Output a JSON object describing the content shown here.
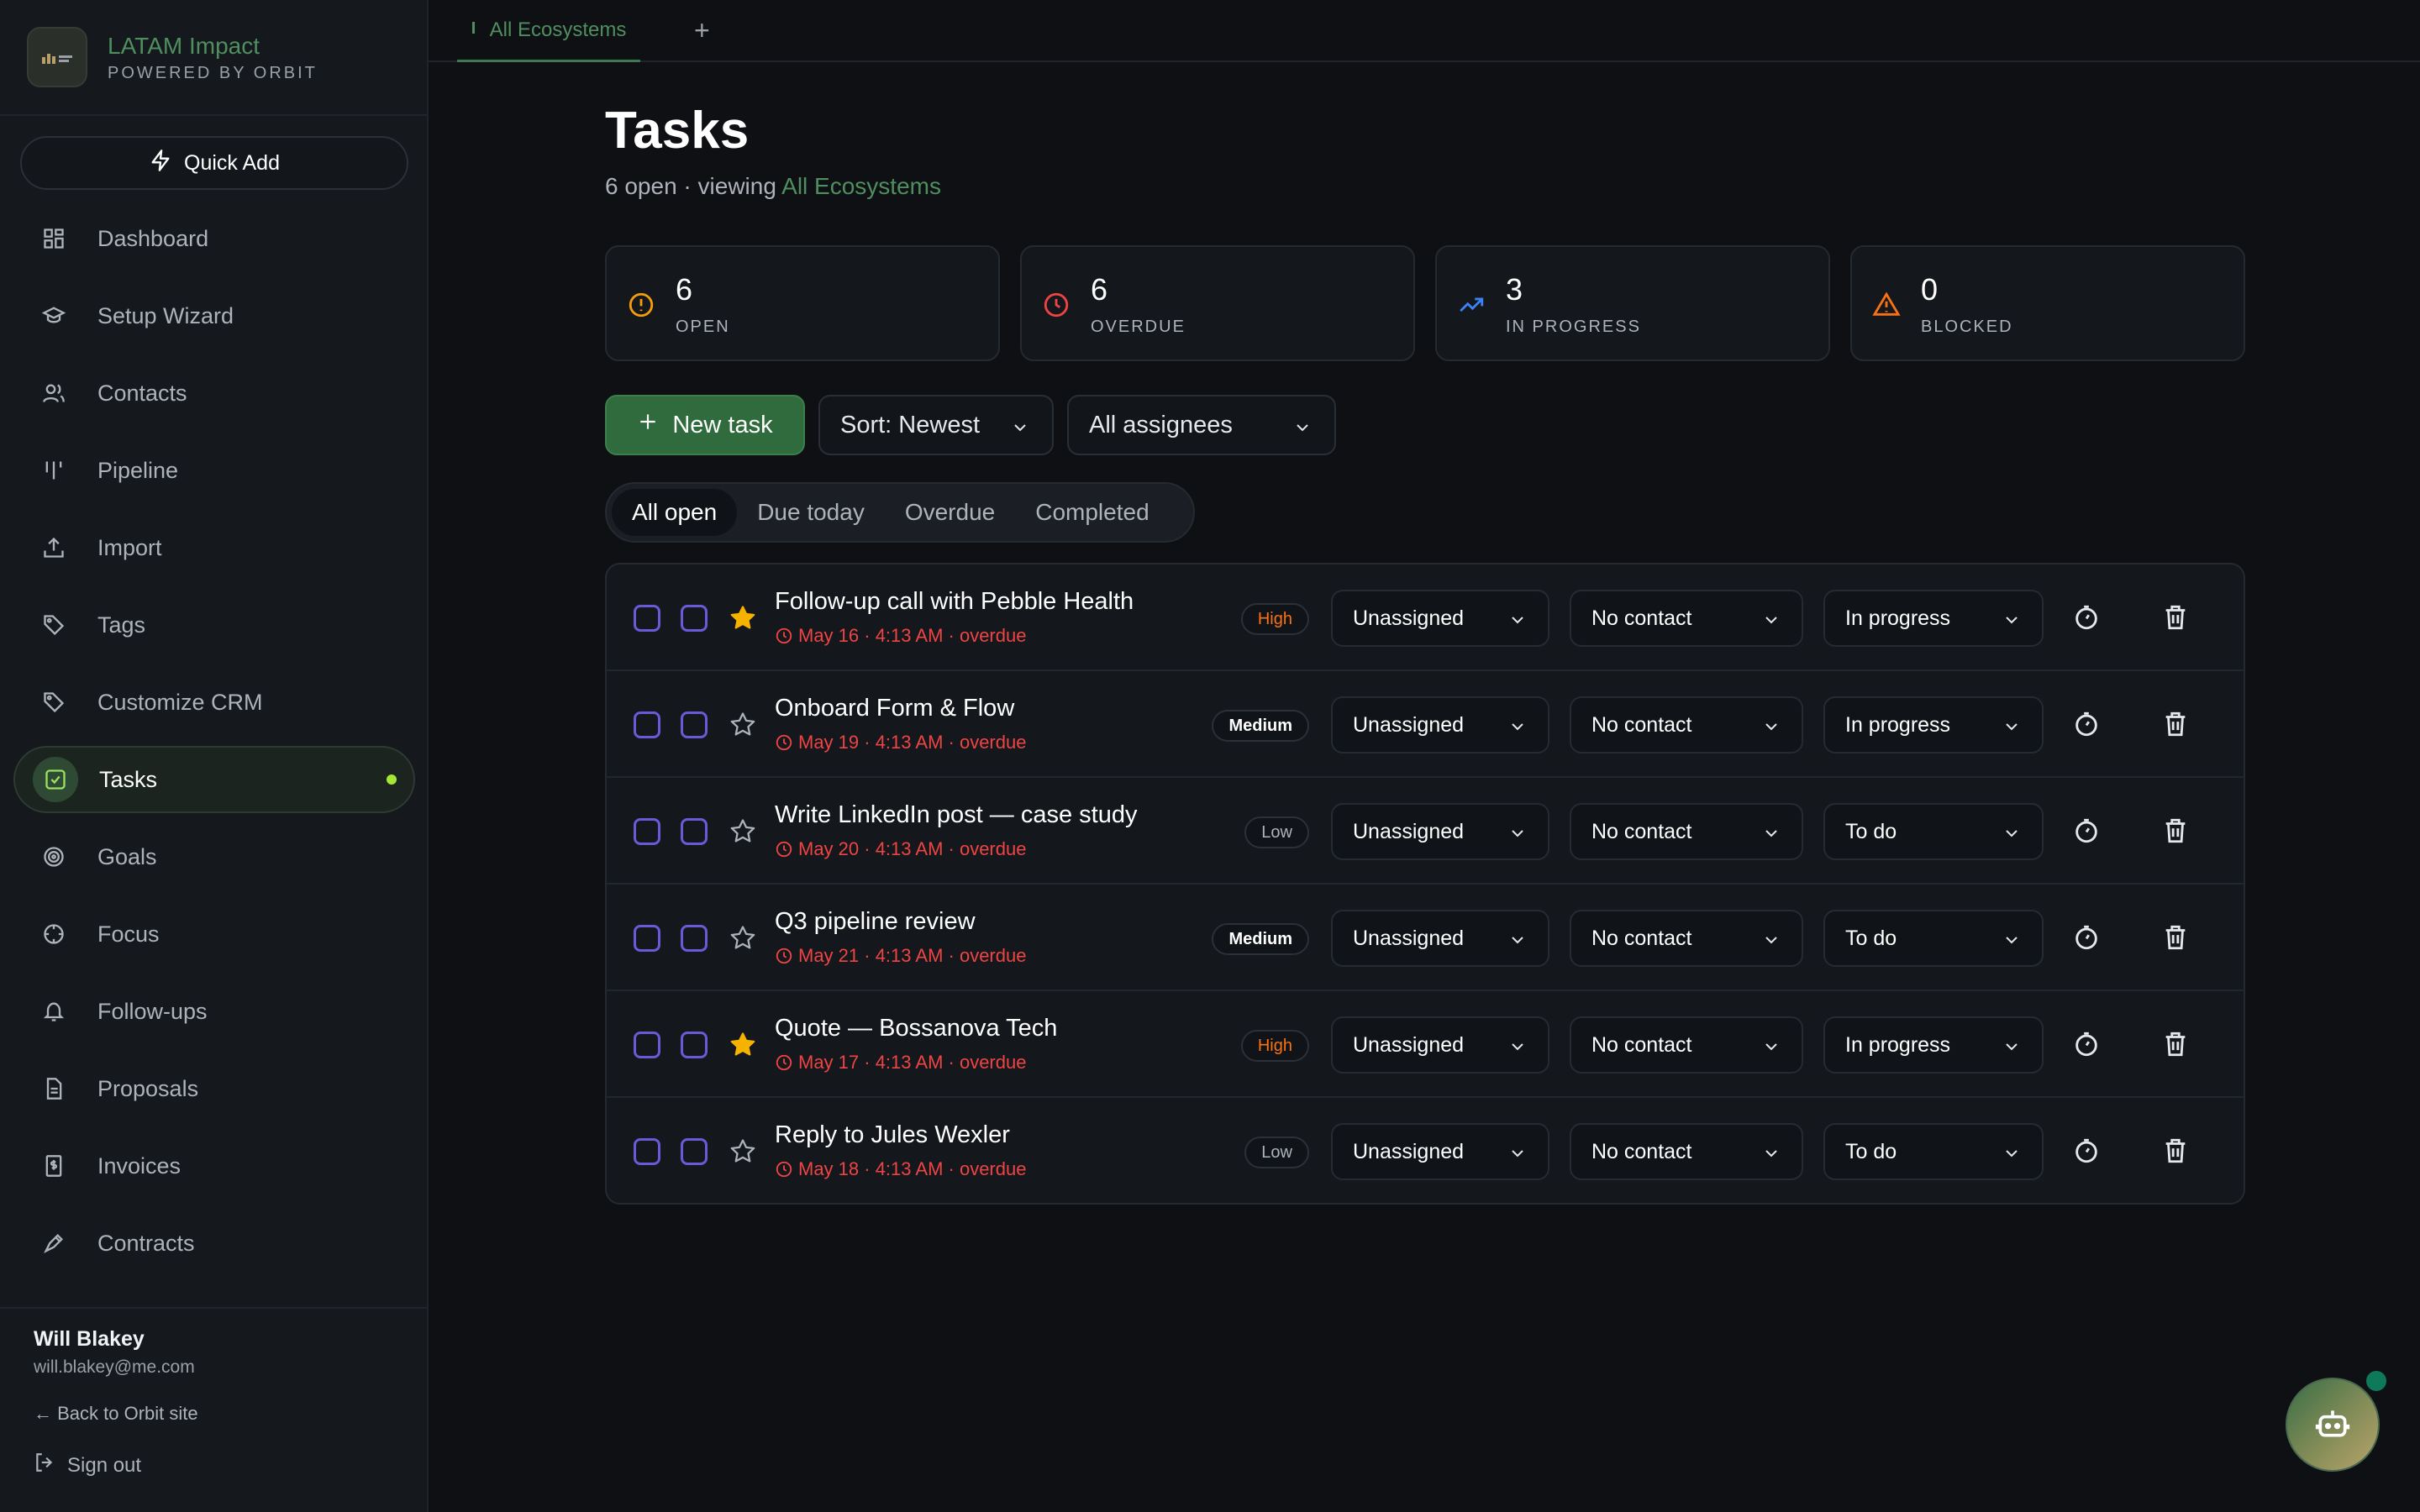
{
  "brand": {
    "name": "LATAM Impact",
    "tagline": "POWERED BY ORBIT"
  },
  "quick_add_label": "Quick Add",
  "nav": [
    {
      "label": "Dashboard",
      "icon": "dashboard-icon"
    },
    {
      "label": "Setup Wizard",
      "icon": "graduation-cap-icon"
    },
    {
      "label": "Contacts",
      "icon": "users-icon"
    },
    {
      "label": "Pipeline",
      "icon": "pipeline-icon"
    },
    {
      "label": "Import",
      "icon": "upload-icon"
    },
    {
      "label": "Tags",
      "icon": "tag-icon"
    },
    {
      "label": "Customize CRM",
      "icon": "tag-icon"
    },
    {
      "label": "Tasks",
      "icon": "checkbox-icon",
      "active": true
    },
    {
      "label": "Goals",
      "icon": "target-icon"
    },
    {
      "label": "Focus",
      "icon": "crosshair-icon"
    },
    {
      "label": "Follow-ups",
      "icon": "bell-icon"
    },
    {
      "label": "Proposals",
      "icon": "document-icon"
    },
    {
      "label": "Invoices",
      "icon": "invoice-icon"
    },
    {
      "label": "Contracts",
      "icon": "pen-icon"
    }
  ],
  "user": {
    "name": "Will Blakey",
    "email": "will.blakey@me.com"
  },
  "back_link": "← Back to Orbit site",
  "sign_out": "Sign out",
  "top_tab": "All Ecosystems",
  "add_tab": "+",
  "page": {
    "title": "Tasks",
    "subtitle_prefix": "6 open · viewing",
    "subtitle_accent": "All Ecosystems"
  },
  "stats": [
    {
      "value": "6",
      "label": "OPEN",
      "icon": "alert-circle-icon",
      "color": "#f59e0b"
    },
    {
      "value": "6",
      "label": "OVERDUE",
      "icon": "clock-icon",
      "color": "#ef4444"
    },
    {
      "value": "3",
      "label": "IN PROGRESS",
      "icon": "trending-up-icon",
      "color": "#3b82f6"
    },
    {
      "value": "0",
      "label": "BLOCKED",
      "icon": "warning-triangle-icon",
      "color": "#f97316"
    }
  ],
  "toolbar": {
    "new_task": "New task",
    "sort": "Sort: Newest",
    "assignees": "All assignees"
  },
  "filter_tabs": [
    "All open",
    "Due today",
    "Overdue",
    "Completed"
  ],
  "tasks": [
    {
      "title": "Follow-up call with Pebble Health",
      "due": "May 16 · 4:13 AM · overdue",
      "priority": "High",
      "assignee": "Unassigned",
      "contact": "No contact",
      "status": "In progress",
      "starred": true
    },
    {
      "title": "Onboard Form & Flow",
      "due": "May 19 · 4:13 AM · overdue",
      "priority": "Medium",
      "assignee": "Unassigned",
      "contact": "No contact",
      "status": "In progress",
      "starred": false
    },
    {
      "title": "Write LinkedIn post — case study",
      "due": "May 20 · 4:13 AM · overdue",
      "priority": "Low",
      "assignee": "Unassigned",
      "contact": "No contact",
      "status": "To do",
      "starred": false
    },
    {
      "title": "Q3 pipeline review",
      "due": "May 21 · 4:13 AM · overdue",
      "priority": "Medium",
      "assignee": "Unassigned",
      "contact": "No contact",
      "status": "To do",
      "starred": false
    },
    {
      "title": "Quote — Bossanova Tech",
      "due": "May 17 · 4:13 AM · overdue",
      "priority": "High",
      "assignee": "Unassigned",
      "contact": "No contact",
      "status": "In progress",
      "starred": true
    },
    {
      "title": "Reply to Jules Wexler",
      "due": "May 18 · 4:13 AM · overdue",
      "priority": "Low",
      "assignee": "Unassigned",
      "contact": "No contact",
      "status": "To do",
      "starred": false
    }
  ],
  "colors": {
    "accent": "#4f8f5f",
    "overdue": "#ef4444",
    "star": "#f5b300",
    "checkbox": "#6a5ad8"
  }
}
